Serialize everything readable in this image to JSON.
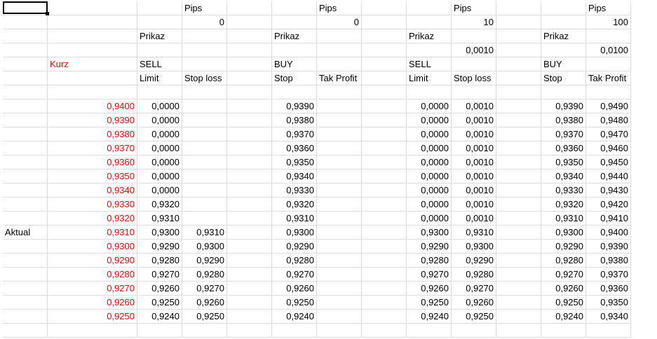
{
  "sheet": {
    "rows": [
      {
        "cells": [
          null,
          null,
          null,
          {
            "t": "Pips"
          },
          null,
          null,
          {
            "t": "Pips"
          },
          null,
          null,
          {
            "t": "Pips"
          },
          null,
          null,
          {
            "t": "Pips"
          }
        ]
      },
      {
        "cells": [
          null,
          null,
          null,
          {
            "t": "0",
            "n": 1
          },
          null,
          null,
          {
            "t": "0",
            "n": 1
          },
          null,
          null,
          {
            "t": "10",
            "n": 1
          },
          null,
          null,
          {
            "t": "100",
            "n": 1
          }
        ]
      },
      {
        "cells": [
          null,
          null,
          {
            "t": "Prikaz"
          },
          null,
          null,
          {
            "t": "Prikaz"
          },
          null,
          null,
          {
            "t": "Prikaz"
          },
          null,
          null,
          {
            "t": "Prikaz"
          },
          null
        ]
      },
      {
        "cells": [
          null,
          null,
          null,
          null,
          null,
          null,
          null,
          null,
          null,
          {
            "t": "0,0010",
            "n": 1
          },
          null,
          null,
          {
            "t": "0,0100",
            "n": 1
          }
        ]
      },
      {
        "cells": [
          null,
          {
            "t": "Kurz",
            "r": 1
          },
          {
            "t": "SELL"
          },
          null,
          null,
          {
            "t": "BUY"
          },
          null,
          null,
          {
            "t": "SELL"
          },
          null,
          null,
          {
            "t": "BUY"
          },
          null
        ]
      },
      {
        "cells": [
          null,
          null,
          {
            "t": "Limit"
          },
          {
            "t": "Stop loss"
          },
          null,
          {
            "t": "Stop"
          },
          {
            "t": "Tak Profit"
          },
          null,
          {
            "t": "Limit"
          },
          {
            "t": "Stop loss"
          },
          null,
          {
            "t": "Stop"
          },
          {
            "t": "Tak Profit"
          }
        ]
      },
      {
        "cells": []
      },
      {
        "cells": [
          null,
          {
            "t": "0,9400",
            "n": 1,
            "r": 1
          },
          {
            "t": "0,0000",
            "n": 1
          },
          null,
          null,
          {
            "t": "0,9390",
            "n": 1
          },
          null,
          null,
          {
            "t": "0,0000",
            "n": 1
          },
          {
            "t": "0,0010",
            "n": 1
          },
          null,
          {
            "t": "0,9390",
            "n": 1
          },
          {
            "t": "0,9490",
            "n": 1
          }
        ]
      },
      {
        "cells": [
          null,
          {
            "t": "0,9390",
            "n": 1,
            "r": 1
          },
          {
            "t": "0,0000",
            "n": 1
          },
          null,
          null,
          {
            "t": "0,9380",
            "n": 1
          },
          null,
          null,
          {
            "t": "0,0000",
            "n": 1
          },
          {
            "t": "0,0010",
            "n": 1
          },
          null,
          {
            "t": "0,9380",
            "n": 1
          },
          {
            "t": "0,9480",
            "n": 1
          }
        ]
      },
      {
        "cells": [
          null,
          {
            "t": "0,9380",
            "n": 1,
            "r": 1
          },
          {
            "t": "0,0000",
            "n": 1
          },
          null,
          null,
          {
            "t": "0,9370",
            "n": 1
          },
          null,
          null,
          {
            "t": "0,0000",
            "n": 1
          },
          {
            "t": "0,0010",
            "n": 1
          },
          null,
          {
            "t": "0,9370",
            "n": 1
          },
          {
            "t": "0,9470",
            "n": 1
          }
        ]
      },
      {
        "cells": [
          null,
          {
            "t": "0,9370",
            "n": 1,
            "r": 1
          },
          {
            "t": "0,0000",
            "n": 1
          },
          null,
          null,
          {
            "t": "0,9360",
            "n": 1
          },
          null,
          null,
          {
            "t": "0,0000",
            "n": 1
          },
          {
            "t": "0,0010",
            "n": 1
          },
          null,
          {
            "t": "0,9360",
            "n": 1
          },
          {
            "t": "0,9460",
            "n": 1
          }
        ]
      },
      {
        "cells": [
          null,
          {
            "t": "0,9360",
            "n": 1,
            "r": 1
          },
          {
            "t": "0,0000",
            "n": 1
          },
          null,
          null,
          {
            "t": "0,9350",
            "n": 1
          },
          null,
          null,
          {
            "t": "0,0000",
            "n": 1
          },
          {
            "t": "0,0010",
            "n": 1
          },
          null,
          {
            "t": "0,9350",
            "n": 1
          },
          {
            "t": "0,9450",
            "n": 1
          }
        ]
      },
      {
        "cells": [
          null,
          {
            "t": "0,9350",
            "n": 1,
            "r": 1
          },
          {
            "t": "0,0000",
            "n": 1
          },
          null,
          null,
          {
            "t": "0,9340",
            "n": 1
          },
          null,
          null,
          {
            "t": "0,0000",
            "n": 1
          },
          {
            "t": "0,0010",
            "n": 1
          },
          null,
          {
            "t": "0,9340",
            "n": 1
          },
          {
            "t": "0,9440",
            "n": 1
          }
        ]
      },
      {
        "cells": [
          null,
          {
            "t": "0,9340",
            "n": 1,
            "r": 1
          },
          {
            "t": "0,0000",
            "n": 1
          },
          null,
          null,
          {
            "t": "0,9330",
            "n": 1
          },
          null,
          null,
          {
            "t": "0,0000",
            "n": 1
          },
          {
            "t": "0,0010",
            "n": 1
          },
          null,
          {
            "t": "0,9330",
            "n": 1
          },
          {
            "t": "0,9430",
            "n": 1
          }
        ]
      },
      {
        "cells": [
          null,
          {
            "t": "0,9330",
            "n": 1,
            "r": 1
          },
          {
            "t": "0,9320",
            "n": 1
          },
          null,
          null,
          {
            "t": "0,9320",
            "n": 1
          },
          null,
          null,
          {
            "t": "0,0000",
            "n": 1
          },
          {
            "t": "0,0010",
            "n": 1
          },
          null,
          {
            "t": "0,9320",
            "n": 1
          },
          {
            "t": "0,9420",
            "n": 1
          }
        ]
      },
      {
        "cells": [
          null,
          {
            "t": "0,9320",
            "n": 1,
            "r": 1
          },
          {
            "t": "0,9310",
            "n": 1
          },
          null,
          null,
          {
            "t": "0,9310",
            "n": 1
          },
          null,
          null,
          {
            "t": "0,0000",
            "n": 1
          },
          {
            "t": "0,0010",
            "n": 1
          },
          null,
          {
            "t": "0,9310",
            "n": 1
          },
          {
            "t": "0,9410",
            "n": 1
          }
        ]
      },
      {
        "cells": [
          {
            "t": "Aktual"
          },
          {
            "t": "0,9310",
            "n": 1,
            "r": 1
          },
          {
            "t": "0,9300",
            "n": 1
          },
          {
            "t": "0,9310",
            "n": 1
          },
          null,
          {
            "t": "0,9300",
            "n": 1
          },
          null,
          null,
          {
            "t": "0,9300",
            "n": 1
          },
          {
            "t": "0,9310",
            "n": 1
          },
          null,
          {
            "t": "0,9300",
            "n": 1
          },
          {
            "t": "0,9400",
            "n": 1
          }
        ]
      },
      {
        "cells": [
          null,
          {
            "t": "0,9300",
            "n": 1,
            "r": 1
          },
          {
            "t": "0,9290",
            "n": 1
          },
          {
            "t": "0,9300",
            "n": 1
          },
          null,
          {
            "t": "0,9290",
            "n": 1
          },
          null,
          null,
          {
            "t": "0,9290",
            "n": 1
          },
          {
            "t": "0,9300",
            "n": 1
          },
          null,
          {
            "t": "0,9290",
            "n": 1
          },
          {
            "t": "0,9390",
            "n": 1
          }
        ]
      },
      {
        "cells": [
          null,
          {
            "t": "0,9290",
            "n": 1,
            "r": 1
          },
          {
            "t": "0,9280",
            "n": 1
          },
          {
            "t": "0,9290",
            "n": 1
          },
          null,
          {
            "t": "0,9280",
            "n": 1
          },
          null,
          null,
          {
            "t": "0,9280",
            "n": 1
          },
          {
            "t": "0,9290",
            "n": 1
          },
          null,
          {
            "t": "0,9280",
            "n": 1
          },
          {
            "t": "0,9380",
            "n": 1
          }
        ]
      },
      {
        "cells": [
          null,
          {
            "t": "0,9280",
            "n": 1,
            "r": 1
          },
          {
            "t": "0,9270",
            "n": 1
          },
          {
            "t": "0,9280",
            "n": 1
          },
          null,
          {
            "t": "0,9270",
            "n": 1
          },
          null,
          null,
          {
            "t": "0,9270",
            "n": 1
          },
          {
            "t": "0,9280",
            "n": 1
          },
          null,
          {
            "t": "0,9270",
            "n": 1
          },
          {
            "t": "0,9370",
            "n": 1
          }
        ]
      },
      {
        "cells": [
          null,
          {
            "t": "0,9270",
            "n": 1,
            "r": 1
          },
          {
            "t": "0,9260",
            "n": 1
          },
          {
            "t": "0,9270",
            "n": 1
          },
          null,
          {
            "t": "0,9260",
            "n": 1
          },
          null,
          null,
          {
            "t": "0,9260",
            "n": 1
          },
          {
            "t": "0,9270",
            "n": 1
          },
          null,
          {
            "t": "0,9260",
            "n": 1
          },
          {
            "t": "0,9360",
            "n": 1
          }
        ]
      },
      {
        "cells": [
          null,
          {
            "t": "0,9260",
            "n": 1,
            "r": 1
          },
          {
            "t": "0,9250",
            "n": 1
          },
          {
            "t": "0,9260",
            "n": 1
          },
          null,
          {
            "t": "0,9250",
            "n": 1
          },
          null,
          null,
          {
            "t": "0,9250",
            "n": 1
          },
          {
            "t": "0,9260",
            "n": 1
          },
          null,
          {
            "t": "0,9250",
            "n": 1
          },
          {
            "t": "0,9350",
            "n": 1
          }
        ]
      },
      {
        "cells": [
          null,
          {
            "t": "0,9250",
            "n": 1,
            "r": 1
          },
          {
            "t": "0,9240",
            "n": 1
          },
          {
            "t": "0,9250",
            "n": 1
          },
          null,
          {
            "t": "0,9240",
            "n": 1
          },
          null,
          null,
          {
            "t": "0,9240",
            "n": 1
          },
          {
            "t": "0,9250",
            "n": 1
          },
          null,
          {
            "t": "0,9240",
            "n": 1
          },
          {
            "t": "0,9340",
            "n": 1
          }
        ]
      },
      {
        "cells": []
      }
    ]
  }
}
